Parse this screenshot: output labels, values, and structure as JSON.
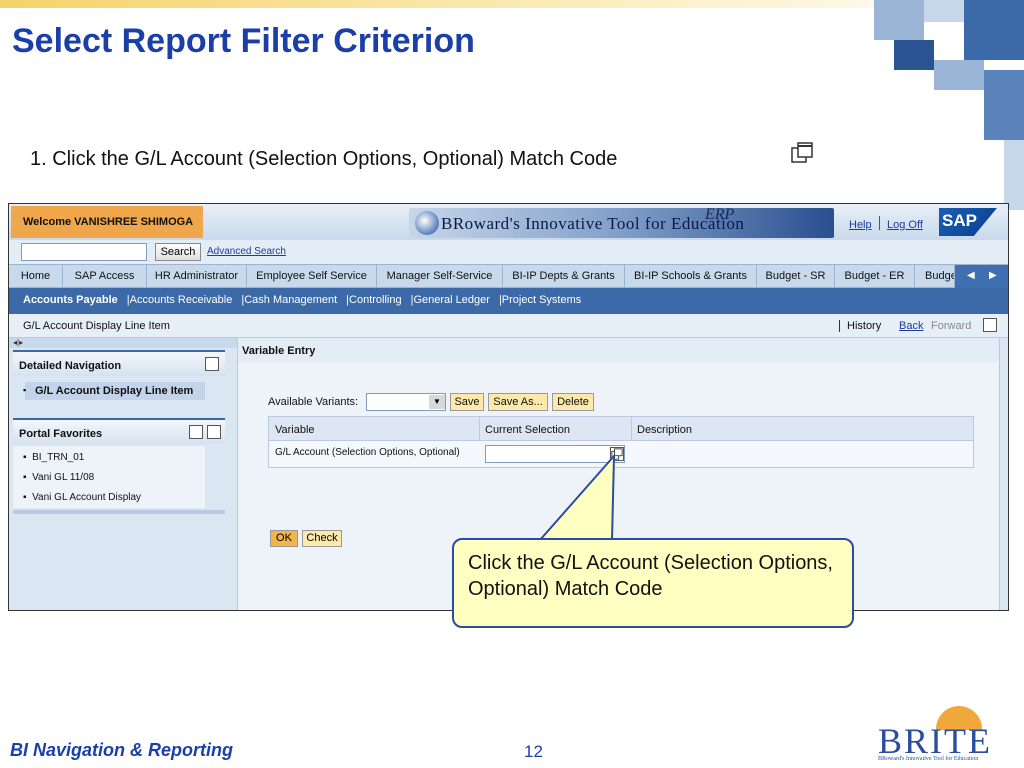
{
  "slide": {
    "title": "Select Report Filter Criterion",
    "instruction": "1.  Click the G/L Account (Selection Options, Optional) Match Code",
    "instruction_icon": "match-code-icon",
    "footer_title": "BI Navigation & Reporting",
    "page_number": "12",
    "logo_word": "BRITE",
    "logo_tagline": "BRoward's Innovative Tool for Education",
    "callout_text": "Click the G/L Account (Selection Options, Optional) Match Code",
    "colors": {
      "title_blue": "#1b3fa8",
      "callout_fill": "#ffffc2",
      "welcome_orange": "#f0a64a"
    }
  },
  "portal": {
    "welcome": "Welcome VANISHREE SHIMOGA",
    "banner_text": "BRoward's Innovative Tool for Education",
    "banner_tag": "ERP",
    "help": "Help",
    "logoff": "Log Off",
    "sap_logo": "SAP",
    "search": {
      "placeholder": "",
      "button": "Search",
      "advanced": "Advanced Search"
    },
    "tabs": [
      "Home",
      "SAP Access",
      "HR Administrator",
      "Employee Self Service",
      "Manager Self-Service",
      "BI-IP Depts & Grants",
      "BI-IP Schools & Grants",
      "Budget - SR",
      "Budget - ER",
      "Budge"
    ],
    "sub_tabs": [
      "Accounts Payable",
      "Accounts Receivable",
      "Cash Management",
      "Controlling",
      "General Ledger",
      "Project Systems"
    ],
    "page_title": "G/L Account Display Line Item",
    "history": "History",
    "back": "Back",
    "forward": "Forward"
  },
  "left": {
    "detailed_nav_title": "Detailed Navigation",
    "detailed_nav_item": "G/L Account Display Line Item",
    "portal_fav_title": "Portal Favorites",
    "favorites": [
      "BI_TRN_01",
      "Vani GL 11/08",
      "Vani GL Account Display"
    ]
  },
  "main": {
    "section_title": "Variable Entry",
    "variants_label": "Available Variants:",
    "buttons": {
      "save": "Save",
      "save_as": "Save As...",
      "delete": "Delete",
      "ok": "OK",
      "check": "Check"
    },
    "table": {
      "headers": [
        "Variable",
        "Current Selection",
        "Description"
      ],
      "row": {
        "variable": "G/L Account (Selection Options, Optional)",
        "current": "",
        "description": ""
      }
    }
  }
}
